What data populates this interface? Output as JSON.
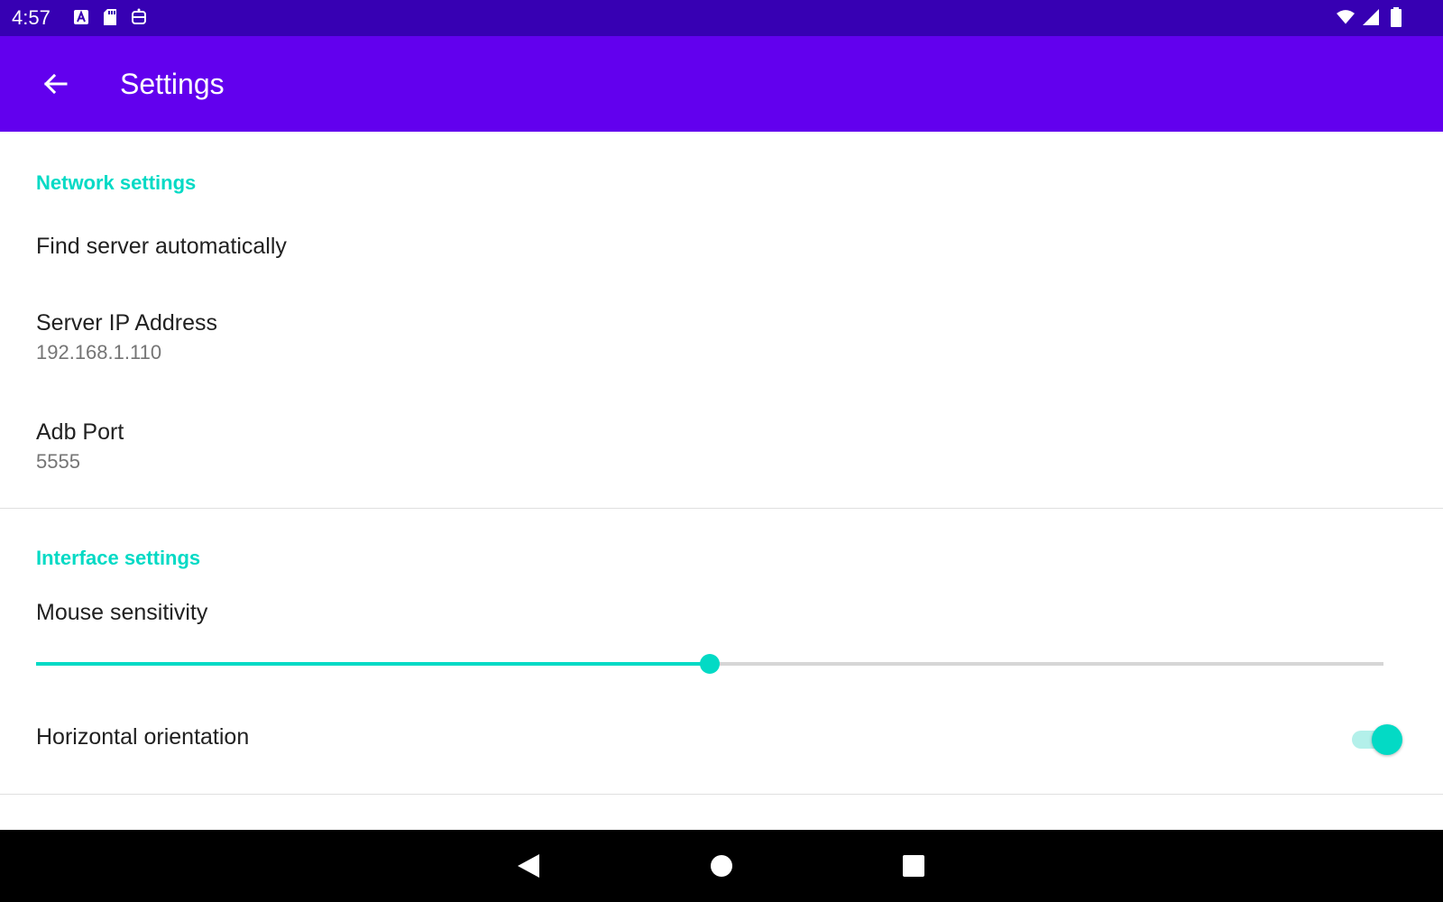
{
  "status_bar": {
    "time": "4:57",
    "left_icons": [
      "accessibility-a-icon",
      "sd-card-icon",
      "robot-icon"
    ],
    "right_icons": [
      "wifi-icon",
      "signal-icon",
      "battery-icon"
    ]
  },
  "app_bar": {
    "back_icon": "arrow-left-icon",
    "title": "Settings",
    "color": "#6200ee"
  },
  "sections": {
    "network": {
      "header": "Network settings",
      "find_server": {
        "title": "Find server automatically"
      },
      "server_ip": {
        "title": "Server IP Address",
        "summary": "192.168.1.110"
      },
      "adb_port": {
        "title": "Adb Port",
        "summary": "5555"
      }
    },
    "interface": {
      "header": "Interface settings",
      "mouse_sensitivity": {
        "title": "Mouse sensitivity",
        "level_fraction": 0.5
      },
      "horizontal_orientation": {
        "title": "Horizontal orientation",
        "enabled": true
      }
    }
  },
  "accent_color": "#03dac5",
  "nav_bar": {
    "buttons": [
      "back-triangle-icon",
      "home-circle-icon",
      "recents-square-icon"
    ]
  }
}
